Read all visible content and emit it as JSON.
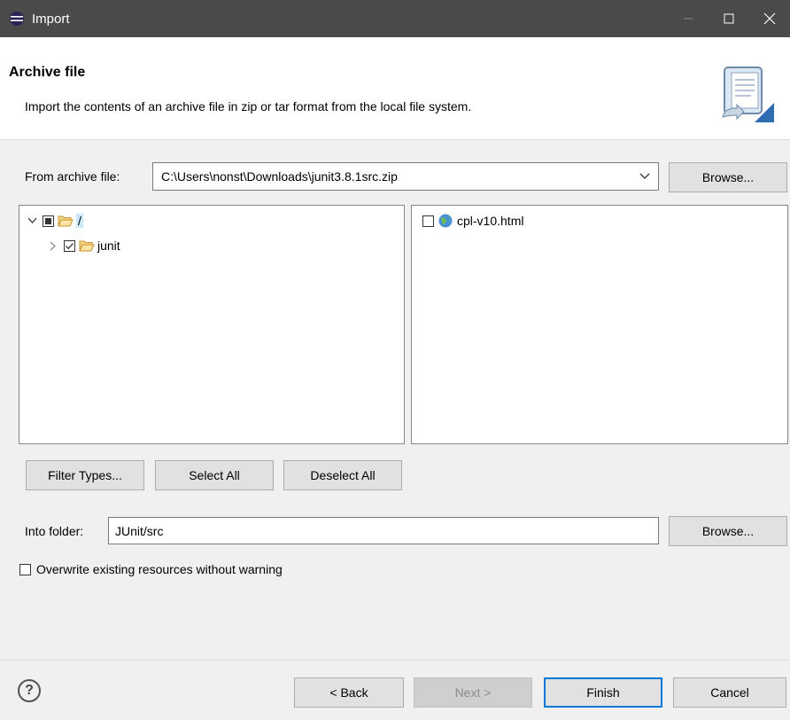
{
  "window": {
    "title": "Import"
  },
  "banner": {
    "title": "Archive file",
    "description": "Import the contents of an archive file in zip or tar format from the local file system."
  },
  "source": {
    "label": "From archive file:",
    "value": "C:\\Users\\nonst\\Downloads\\junit3.8.1src.zip",
    "browse_label": "Browse..."
  },
  "tree": [
    {
      "label": "/",
      "state": "partial",
      "expanded": true
    },
    {
      "label": "junit",
      "state": "checked",
      "expanded": false
    }
  ],
  "files": [
    {
      "label": "cpl-v10.html",
      "checked": false
    }
  ],
  "buttons": {
    "filter_types": "Filter Types...",
    "select_all": "Select All",
    "deselect_all": "Deselect All"
  },
  "destination": {
    "label": "Into folder:",
    "value": "JUnit/src",
    "browse_label": "Browse..."
  },
  "options": {
    "overwrite_label": "Overwrite existing resources without warning",
    "overwrite_checked": false
  },
  "footer": {
    "help": "?",
    "back": "< Back",
    "next": "Next >",
    "finish": "Finish",
    "cancel": "Cancel"
  }
}
